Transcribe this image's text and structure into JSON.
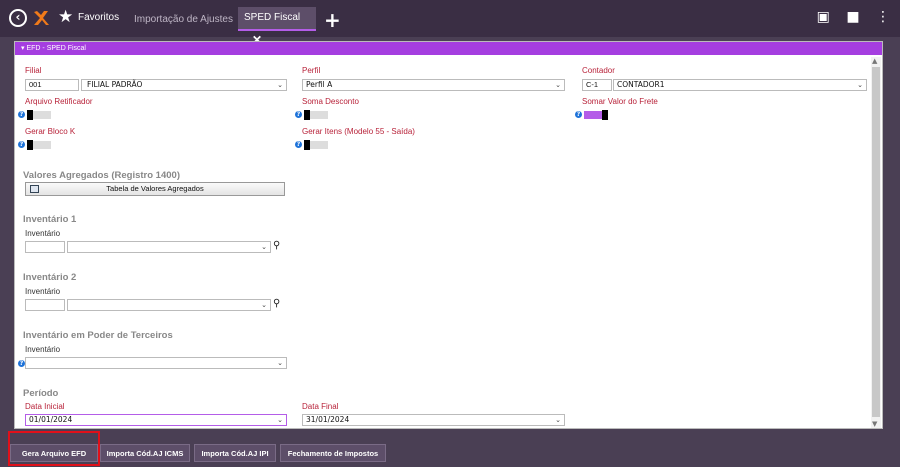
{
  "topbar": {
    "tabs": [
      {
        "label": "Favoritos"
      },
      {
        "label": "Importação de Ajustes"
      },
      {
        "label": "SPED Fiscal"
      }
    ]
  },
  "panel": {
    "title": "EFD - SPED Fiscal",
    "filial": {
      "label": "Filial",
      "code": "001",
      "name": "FILIAL PADRÃO"
    },
    "perfil": {
      "label": "Perfil",
      "value": "Perfil A"
    },
    "contador": {
      "label": "Contador",
      "code": "C-1",
      "name": "CONTADOR1"
    },
    "arquivo_retificador": {
      "label": "Arquivo Retificador",
      "on": false
    },
    "soma_desconto": {
      "label": "Soma Desconto",
      "on": false
    },
    "somar_frete": {
      "label": "Somar Valor do Frete",
      "on": true
    },
    "gerar_bloco_k": {
      "label": "Gerar Bloco K",
      "on": false
    },
    "gerar_itens": {
      "label": "Gerar Itens (Modelo 55 - Saída)",
      "on": false
    },
    "valores_agregados": {
      "title": "Valores Agregados (Registro 1400)",
      "button": "Tabela de Valores Agregados"
    },
    "inventario1": {
      "title": "Inventário 1",
      "field_label": "Inventário"
    },
    "inventario2": {
      "title": "Inventário 2",
      "field_label": "Inventário"
    },
    "inventario3": {
      "title": "Inventário em Poder de Terceiros",
      "field_label": "Inventário"
    },
    "periodo": {
      "title": "Período",
      "data_inicial": {
        "label": "Data Inicial",
        "value": "01/01/2024"
      },
      "data_final": {
        "label": "Data Final",
        "value": "31/01/2024"
      }
    }
  },
  "bottom_buttons": [
    {
      "label": "Gera Arquivo EFD"
    },
    {
      "label": "Importa Cód.AJ ICMS"
    },
    {
      "label": "Importa Cód.AJ IPI"
    },
    {
      "label": "Fechamento de Impostos"
    }
  ],
  "colors": {
    "accent": "#a53ee0",
    "topbar": "#3a2e44",
    "label_red": "#b8233a",
    "highlight": "#e0101a"
  }
}
